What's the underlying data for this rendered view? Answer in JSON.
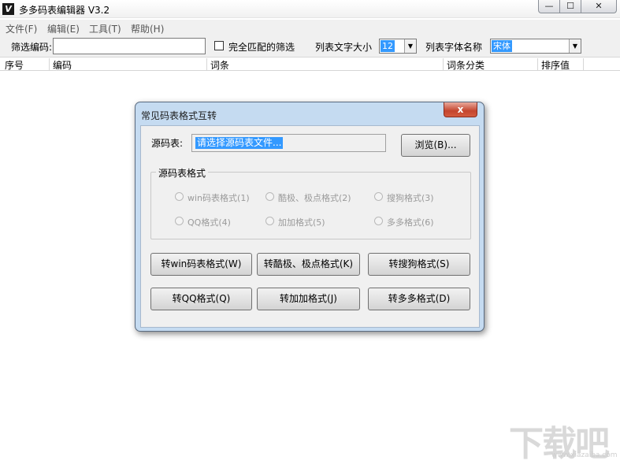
{
  "window": {
    "title": "多多码表编辑器 V3.2",
    "icon": "app-logo-icon",
    "controls": {
      "minimize": "—",
      "maximize": "☐",
      "close": "✕"
    }
  },
  "menu": {
    "items": [
      "文件(F)",
      "编辑(E)",
      "工具(T)",
      "帮助(H)"
    ]
  },
  "filter": {
    "label": "筛选编码:",
    "value": "",
    "exact_match_label": "完全匹配的筛选",
    "exact_match_checked": false,
    "font_size_label": "列表文字大小",
    "font_size_value": "12",
    "font_name_label": "列表字体名称",
    "font_name_value": "宋体"
  },
  "list": {
    "columns": [
      "序号",
      "编码",
      "词条",
      "词条分类",
      "排序值"
    ]
  },
  "dialog": {
    "title": "常见码表格式互转",
    "close": "x",
    "source_label": "源码表:",
    "source_value": "请选择源码表文件...",
    "browse_label": "浏览(B)...",
    "format_group_label": "源码表格式",
    "formats": [
      "win码表格式(1)",
      "酷极、极点格式(2)",
      "搜狗格式(3)",
      "QQ格式(4)",
      "加加格式(5)",
      "多多格式(6)"
    ],
    "convert_buttons": [
      "转win码表格式(W)",
      "转酷极、极点格式(K)",
      "转搜狗格式(S)",
      "转QQ格式(Q)",
      "转加加格式(J)",
      "转多多格式(D)"
    ]
  },
  "watermark": {
    "logo": "下载吧",
    "site": "www.xiazaiba.com"
  }
}
